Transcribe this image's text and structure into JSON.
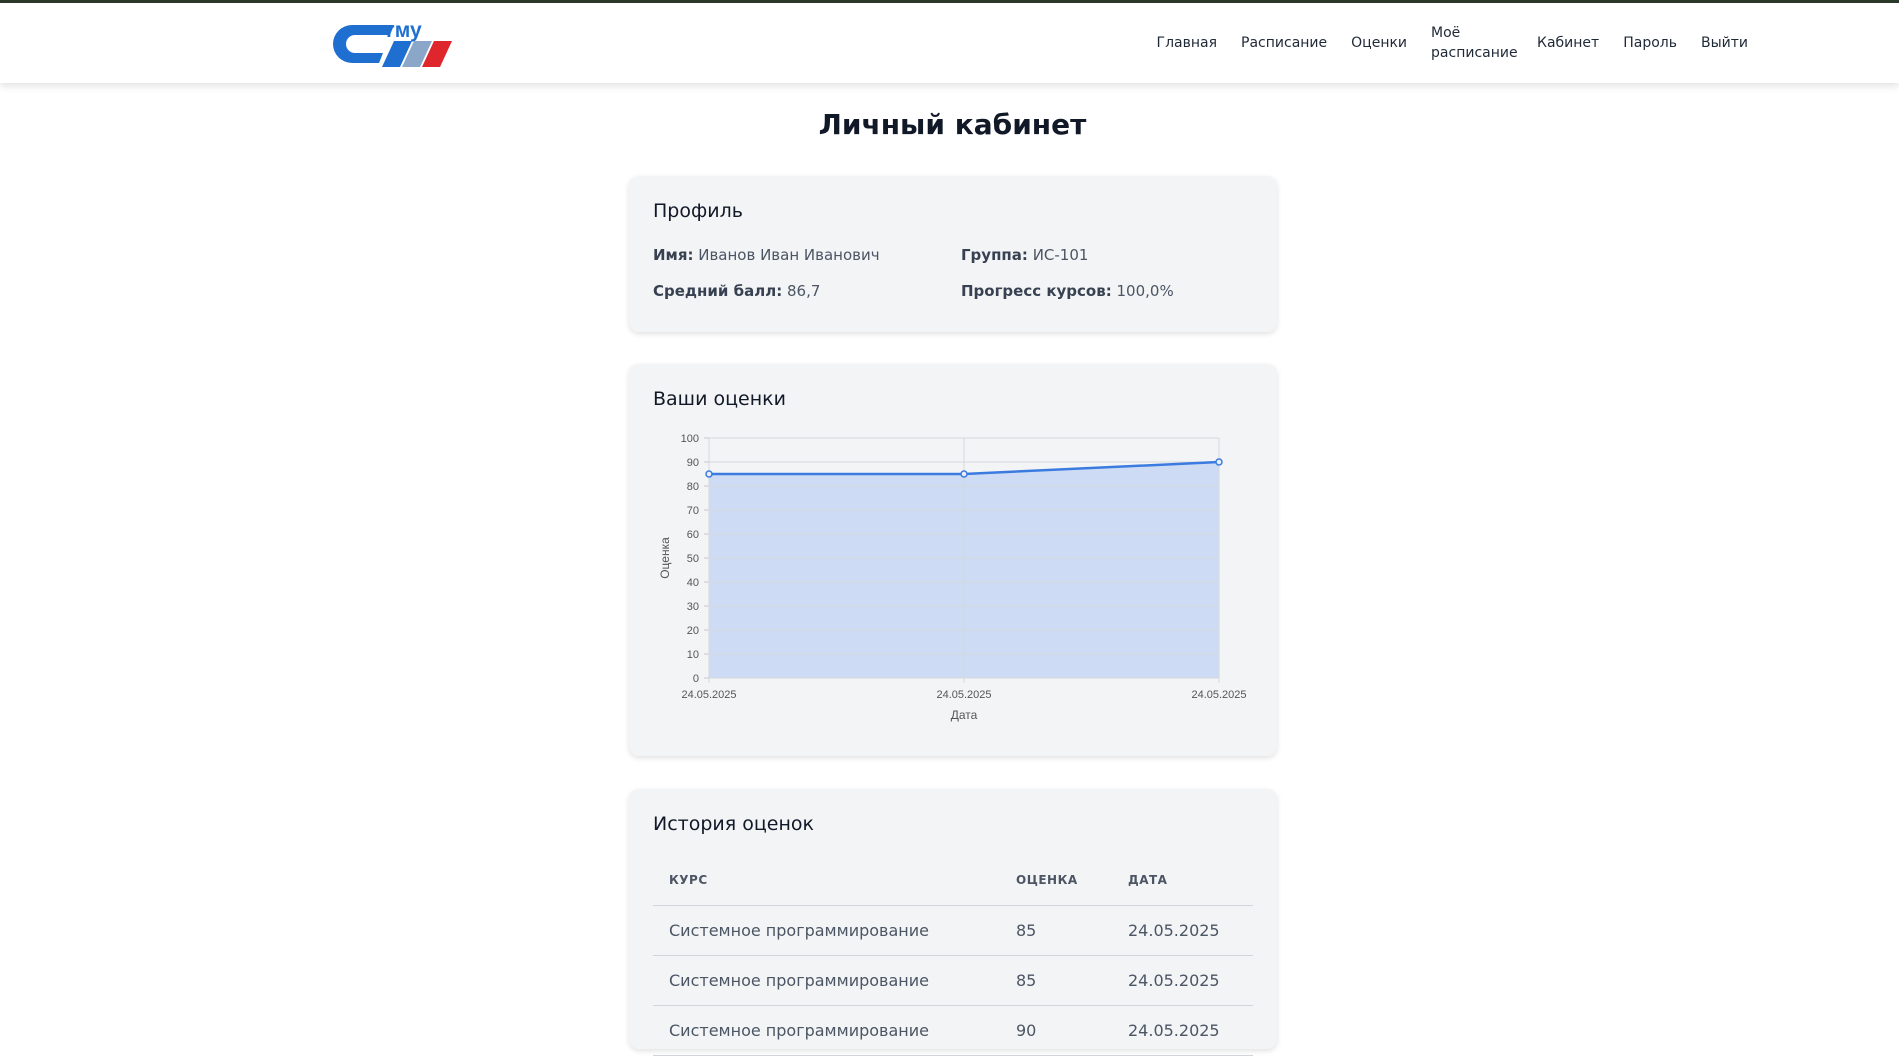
{
  "nav": {
    "items": [
      {
        "label": "Главная"
      },
      {
        "label": "Расписание"
      },
      {
        "label": "Оценки"
      },
      {
        "label": "Моё расписание"
      },
      {
        "label": "Кабинет"
      },
      {
        "label": "Пароль"
      },
      {
        "label": "Выйти"
      }
    ]
  },
  "logo": {
    "text": "гму",
    "colors": {
      "blue": "#1e6fd0",
      "red": "#e0262d"
    }
  },
  "page": {
    "title": "Личный кабинет"
  },
  "profile": {
    "title": "Профиль",
    "name_label": "Имя:",
    "name_value": "Иванов Иван Иванович",
    "group_label": "Группа:",
    "group_value": "ИС-101",
    "avg_label": "Средний балл:",
    "avg_value": "86,7",
    "progress_label": "Прогресс курсов:",
    "progress_value": "100,0%"
  },
  "grades_chart": {
    "title": "Ваши оценки"
  },
  "chart_data": {
    "type": "line",
    "categories": [
      "24.05.2025",
      "24.05.2025",
      "24.05.2025"
    ],
    "series": [
      {
        "values": [
          85,
          85,
          90
        ]
      }
    ],
    "xlabel": "Дата",
    "ylabel": "Оценка",
    "ylim": [
      0,
      100
    ],
    "yticks": [
      0,
      10,
      20,
      30,
      40,
      50,
      60,
      70,
      80,
      90,
      100
    ],
    "grid": true,
    "filled": true,
    "line_color": "#3b7be0",
    "fill_color": "#cddcf4"
  },
  "history": {
    "title": "История оценок",
    "columns": [
      "КУРС",
      "ОЦЕНКА",
      "ДАТА"
    ],
    "rows": [
      {
        "course": "Системное программирование",
        "grade": "85",
        "date": "24.05.2025"
      },
      {
        "course": "Системное программирование",
        "grade": "85",
        "date": "24.05.2025"
      },
      {
        "course": "Системное программирование",
        "grade": "90",
        "date": "24.05.2025"
      }
    ]
  }
}
